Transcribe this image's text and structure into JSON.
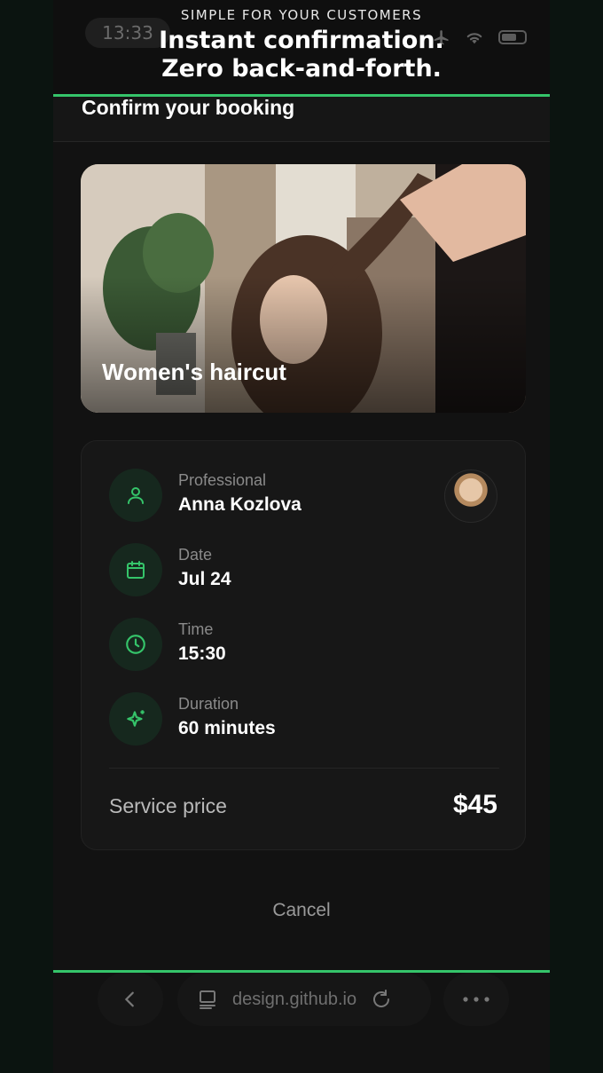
{
  "caption": {
    "eyebrow": "SIMPLE FOR YOUR CUSTOMERS",
    "headline_line1": "Instant confirmation.",
    "headline_line2": "Zero back-and-forth."
  },
  "status_bar": {
    "time": "13:33"
  },
  "header": {
    "title": "Confirm your booking"
  },
  "service": {
    "name": "Women's haircut"
  },
  "details": {
    "professional": {
      "label": "Professional",
      "value": "Anna Kozlova",
      "icon": "person-icon"
    },
    "date": {
      "label": "Date",
      "value": "Jul 24",
      "icon": "calendar-icon"
    },
    "time": {
      "label": "Time",
      "value": "15:30",
      "icon": "clock-icon"
    },
    "duration": {
      "label": "Duration",
      "value": "60 minutes",
      "icon": "sparkle-icon"
    }
  },
  "price": {
    "label": "Service price",
    "value": "$45"
  },
  "actions": {
    "cancel": "Cancel"
  },
  "browser": {
    "url": "design.github.io"
  },
  "colors": {
    "accent": "#35c46a",
    "background": "#121212",
    "card": "#171717",
    "icon_bg": "#16281e"
  }
}
